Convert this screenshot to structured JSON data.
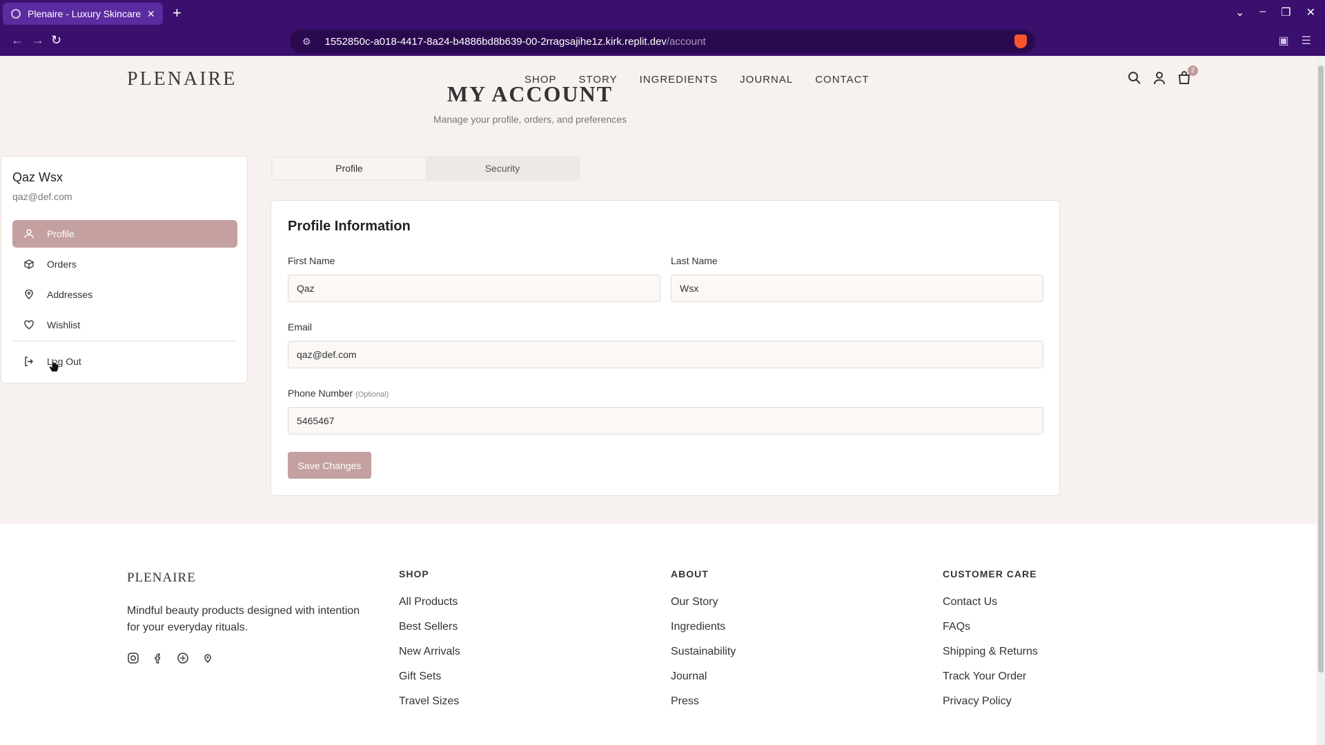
{
  "browser": {
    "tab_title": "Plenaire - Luxury Skincare",
    "url_host": "1552850c-a018-4417-8a24-b4886bd8b639-00-2rragsajihe1z.kirk.replit.dev",
    "url_path": "/account"
  },
  "header": {
    "logo": "PLENAIRE",
    "nav": [
      "SHOP",
      "STORY",
      "INGREDIENTS",
      "JOURNAL",
      "CONTACT"
    ],
    "cart_count": "2",
    "title": "MY ACCOUNT",
    "subtitle": "Manage your profile, orders, and preferences"
  },
  "sidebar": {
    "name": "Qaz Wsx",
    "email": "qaz@def.com",
    "items": [
      {
        "label": "Profile",
        "icon": "user-icon"
      },
      {
        "label": "Orders",
        "icon": "box-icon"
      },
      {
        "label": "Addresses",
        "icon": "map-pin-icon"
      },
      {
        "label": "Wishlist",
        "icon": "heart-icon"
      }
    ],
    "logout": "Log Out"
  },
  "tabs": [
    "Profile",
    "Security"
  ],
  "profile": {
    "title": "Profile Information",
    "first_name_label": "First Name",
    "first_name": "Qaz",
    "last_name_label": "Last Name",
    "last_name": "Wsx",
    "email_label": "Email",
    "email": "qaz@def.com",
    "phone_label": "Phone Number",
    "phone_optional": "(Optional)",
    "phone": "5465467",
    "save": "Save Changes"
  },
  "footer": {
    "logo": "PLENAIRE",
    "tagline": "Mindful beauty products designed with intention for your everyday rituals.",
    "social": [
      "instagram-icon",
      "facebook-icon",
      "pinterest-icon",
      "location-icon"
    ],
    "columns": [
      {
        "title": "SHOP",
        "links": [
          "All Products",
          "Best Sellers",
          "New Arrivals",
          "Gift Sets",
          "Travel Sizes"
        ]
      },
      {
        "title": "ABOUT",
        "links": [
          "Our Story",
          "Ingredients",
          "Sustainability",
          "Journal",
          "Press"
        ]
      },
      {
        "title": "CUSTOMER CARE",
        "links": [
          "Contact Us",
          "FAQs",
          "Shipping & Returns",
          "Track Your Order",
          "Privacy Policy"
        ]
      }
    ]
  },
  "colors": {
    "accent": "#c4a0a0",
    "browser": "#3b0f6d",
    "background": "#f7f2ef"
  }
}
